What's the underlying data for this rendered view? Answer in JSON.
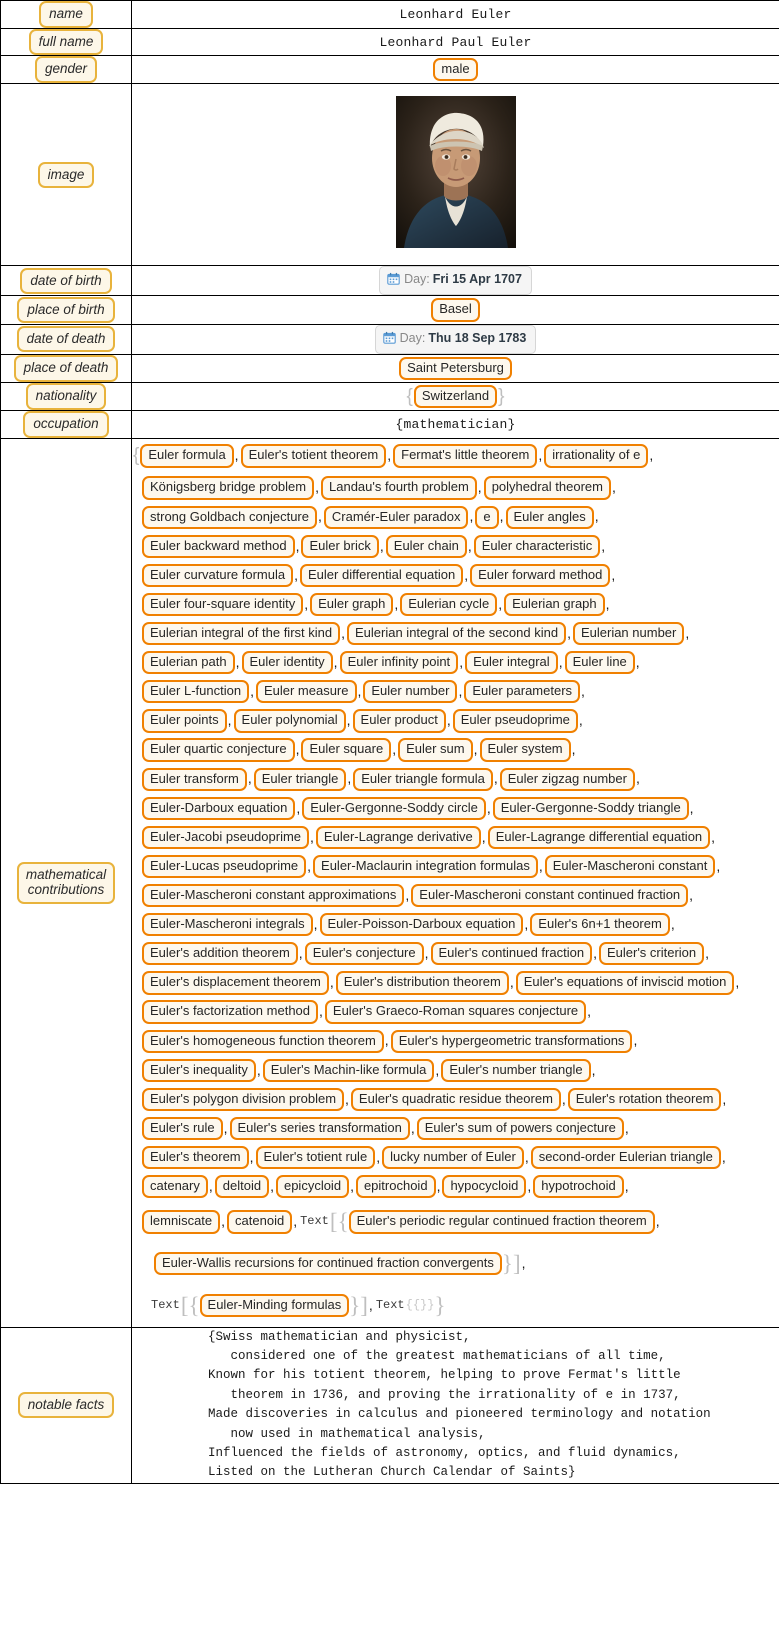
{
  "rows": {
    "name": {
      "label": "name",
      "value": "Leonhard Euler"
    },
    "full_name": {
      "label": "full name",
      "value": "Leonhard Paul Euler"
    },
    "gender": {
      "label": "gender",
      "value": "male"
    },
    "image": {
      "label": "image",
      "alt": "portrait of Leonhard Euler"
    },
    "date_of_birth": {
      "label": "date of birth",
      "prefix": "Day:",
      "value": "Fri 15 Apr 1707",
      "icon": "calendar-icon"
    },
    "place_of_birth": {
      "label": "place of birth",
      "value": "Basel"
    },
    "date_of_death": {
      "label": "date of death",
      "prefix": "Day:",
      "value": "Thu 18 Sep 1783",
      "icon": "calendar-icon"
    },
    "place_of_death": {
      "label": "place of death",
      "value": "Saint Petersburg"
    },
    "nationality": {
      "label": "nationality",
      "value": "Switzerland"
    },
    "occupation": {
      "label": "occupation",
      "value": "{mathematician}"
    },
    "mathematical_contributions": {
      "label_line1": "mathematical",
      "label_line2": "contributions"
    },
    "notable_facts": {
      "label": "notable facts"
    }
  },
  "contributions": {
    "lines": [
      {
        "indent": 0,
        "open_brace": true,
        "items": [
          "Euler formula",
          "Euler's totient theorem",
          "Fermat's little theorem",
          "irrationality of e"
        ]
      },
      {
        "indent": 1,
        "items": [
          "Königsberg bridge problem",
          "Landau's fourth problem",
          "polyhedral theorem"
        ]
      },
      {
        "indent": 1,
        "items": [
          "strong Goldbach conjecture",
          "Cramér-Euler paradox",
          "e",
          "Euler angles"
        ]
      },
      {
        "indent": 1,
        "items": [
          "Euler backward method",
          "Euler brick",
          "Euler chain",
          "Euler characteristic"
        ]
      },
      {
        "indent": 1,
        "items": [
          "Euler curvature formula",
          "Euler differential equation",
          "Euler forward method"
        ]
      },
      {
        "indent": 1,
        "items": [
          "Euler four-square identity",
          "Euler graph",
          "Eulerian cycle",
          "Eulerian graph"
        ]
      },
      {
        "indent": 1,
        "items": [
          "Eulerian integral of the first kind",
          "Eulerian integral of the second kind",
          "Eulerian number"
        ]
      },
      {
        "indent": 1,
        "items": [
          "Eulerian path",
          "Euler identity",
          "Euler infinity point",
          "Euler integral",
          "Euler line"
        ]
      },
      {
        "indent": 1,
        "items": [
          "Euler L-function",
          "Euler measure",
          "Euler number",
          "Euler parameters"
        ]
      },
      {
        "indent": 1,
        "items": [
          "Euler points",
          "Euler polynomial",
          "Euler product",
          "Euler pseudoprime"
        ]
      },
      {
        "indent": 1,
        "items": [
          "Euler quartic conjecture",
          "Euler square",
          "Euler sum",
          "Euler system"
        ]
      },
      {
        "indent": 1,
        "items": [
          "Euler transform",
          "Euler triangle",
          "Euler triangle formula",
          "Euler zigzag number"
        ]
      },
      {
        "indent": 1,
        "items": [
          "Euler-Darboux equation",
          "Euler-Gergonne-Soddy circle",
          "Euler-Gergonne-Soddy triangle"
        ]
      },
      {
        "indent": 1,
        "items": [
          "Euler-Jacobi pseudoprime",
          "Euler-Lagrange derivative",
          "Euler-Lagrange differential equation"
        ]
      },
      {
        "indent": 1,
        "items": [
          "Euler-Lucas pseudoprime",
          "Euler-Maclaurin integration formulas",
          "Euler-Mascheroni constant"
        ]
      },
      {
        "indent": 1,
        "items": [
          "Euler-Mascheroni constant approximations",
          "Euler-Mascheroni constant continued fraction"
        ]
      },
      {
        "indent": 1,
        "items": [
          "Euler-Mascheroni integrals",
          "Euler-Poisson-Darboux equation",
          "Euler's 6n+1 theorem"
        ]
      },
      {
        "indent": 1,
        "items": [
          "Euler's addition theorem",
          "Euler's conjecture",
          "Euler's continued fraction",
          "Euler's criterion"
        ]
      },
      {
        "indent": 1,
        "items": [
          "Euler's displacement theorem",
          "Euler's distribution theorem",
          "Euler's equations of inviscid motion"
        ]
      },
      {
        "indent": 1,
        "items": [
          "Euler's factorization method",
          "Euler's Graeco-Roman squares conjecture"
        ]
      },
      {
        "indent": 1,
        "items": [
          "Euler's homogeneous function theorem",
          "Euler's hypergeometric transformations"
        ]
      },
      {
        "indent": 1,
        "items": [
          "Euler's inequality",
          "Euler's Machin-like formula",
          "Euler's number triangle"
        ]
      },
      {
        "indent": 1,
        "items": [
          "Euler's polygon division problem",
          "Euler's quadratic residue theorem",
          "Euler's rotation theorem"
        ]
      },
      {
        "indent": 1,
        "items": [
          "Euler's rule",
          "Euler's series transformation",
          "Euler's sum of powers conjecture"
        ]
      },
      {
        "indent": 1,
        "items": [
          "Euler's theorem",
          "Euler's totient rule",
          "lucky number of Euler",
          "second-order Eulerian triangle"
        ]
      },
      {
        "indent": 1,
        "items": [
          "catenary",
          "deltoid",
          "epicycloid",
          "epitrochoid",
          "hypocycloid",
          "hypotrochoid"
        ]
      }
    ],
    "tail": {
      "line_a_items": [
        "lemniscate",
        "catenoid"
      ],
      "text_keyword": "Text",
      "nested_item_1": "Euler's periodic regular continued fraction theorem",
      "nested_item_2": "Euler-Wallis recursions for continued fraction convergents",
      "nested_item_3": "Euler-Minding formulas",
      "empty_braces": "{{}}"
    }
  },
  "notable_facts_text": "{Swiss mathematician and physicist,\n   considered one of the greatest mathematicians of all time,\nKnown for his totient theorem, helping to prove Fermat's little\n   theorem in 1736, and proving the irrationality of e in 1737,\nMade discoveries in calculus and pioneered terminology and notation\n   now used in mathematical analysis,\nInfluenced the fields of astronomy, optics, and fluid dynamics,\nListed on the Lutheran Church Calendar of Saints}",
  "colors": {
    "label_border": "#E8B33C",
    "label_bg": "#FDF7E8",
    "pill_border": "#F08000",
    "pill_bg": "#FDF8EE",
    "brace_gray": "#BFBFBF",
    "badge_bg": "#F5F5F5",
    "badge_text": "#2d3a45"
  }
}
